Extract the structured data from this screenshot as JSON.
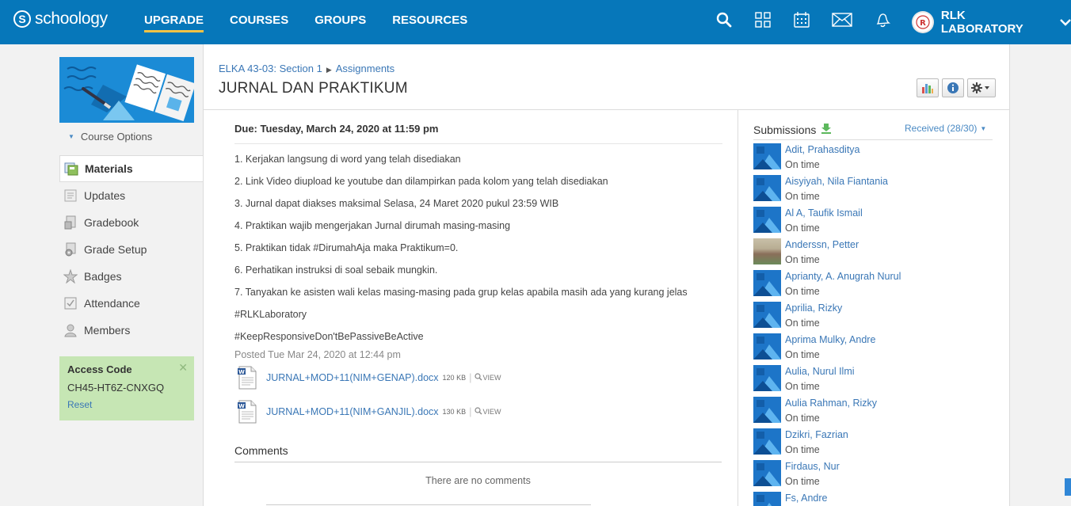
{
  "nav": {
    "logo_text": "schoology",
    "items": [
      {
        "label": "UPGRADE"
      },
      {
        "label": "COURSES"
      },
      {
        "label": "GROUPS"
      },
      {
        "label": "RESOURCES"
      }
    ],
    "user_name": "RLK LABORATORY",
    "icons": [
      "search-icon",
      "apps-grid-icon",
      "calendar-icon",
      "mail-icon",
      "bell-icon"
    ]
  },
  "sidebar": {
    "course_options": "Course Options",
    "items": [
      {
        "label": "Materials",
        "icon": "materials-icon"
      },
      {
        "label": "Updates",
        "icon": "updates-icon"
      },
      {
        "label": "Gradebook",
        "icon": "gradebook-icon"
      },
      {
        "label": "Grade Setup",
        "icon": "grade-setup-icon"
      },
      {
        "label": "Badges",
        "icon": "badge-icon"
      },
      {
        "label": "Attendance",
        "icon": "attendance-icon"
      },
      {
        "label": "Members",
        "icon": "members-icon"
      }
    ],
    "access": {
      "title": "Access Code",
      "code": "CH45-HT6Z-CNXGQ",
      "reset": "Reset"
    }
  },
  "breadcrumb": {
    "course": "ELKA 43-03: Section 1",
    "section": "Assignments"
  },
  "page_title": "JURNAL DAN PRAKTIKUM",
  "assignment": {
    "due": "Due: Tuesday, March 24, 2020 at 11:59 pm",
    "lines": [
      "1. Kerjakan langsung di word yang telah disediakan",
      "2. Link Video diupload ke youtube dan dilampirkan pada kolom yang telah disediakan",
      "3. Jurnal dapat diakses maksimal Selasa, 24 Maret 2020 pukul 23:59 WIB",
      "4. Praktikan wajib mengerjakan Jurnal dirumah masing-masing",
      "5. Praktikan tidak #DirumahAja maka Praktikum=0.",
      "6. Perhatikan instruksi di soal sebaik mungkin.",
      "7. Tanyakan ke asisten wali kelas masing-masing pada grup kelas apabila masih ada yang kurang jelas",
      "#RLKLaboratory",
      "#KeepResponsiveDon'tBePassiveBeActive"
    ],
    "posted": "Posted Tue Mar 24, 2020 at 12:44 pm",
    "files": [
      {
        "name": "JURNAL+MOD+11(NIM+GENAP).docx",
        "size": "120 KB",
        "view": "VIEW"
      },
      {
        "name": "JURNAL+MOD+11(NIM+GANJIL).docx",
        "size": "130 KB",
        "view": "VIEW"
      }
    ]
  },
  "comments": {
    "title": "Comments",
    "empty": "There are no comments"
  },
  "submissions": {
    "title": "Submissions",
    "received": "Received (28/30)",
    "items": [
      {
        "name": "Adit, Prahasditya",
        "status": "On time"
      },
      {
        "name": "Aisyiyah, Nila Fiantania",
        "status": "On time"
      },
      {
        "name": "Al A, Taufik Ismail",
        "status": "On time"
      },
      {
        "name": "Anderssn, Petter",
        "status": "On time"
      },
      {
        "name": "Aprianty, A. Anugrah Nurul",
        "status": "On time"
      },
      {
        "name": "Aprilia, Rizky",
        "status": "On time"
      },
      {
        "name": "Aprima Mulky, Andre",
        "status": "On time"
      },
      {
        "name": "Aulia, Nurul Ilmi",
        "status": "On time"
      },
      {
        "name": "Aulia Rahman, Rizky",
        "status": "On time"
      },
      {
        "name": "Dzikri, Fazrian",
        "status": "On time"
      },
      {
        "name": "Firdaus, Nur",
        "status": "On time"
      },
      {
        "name": "Fs, Andre",
        "status": ""
      }
    ]
  }
}
